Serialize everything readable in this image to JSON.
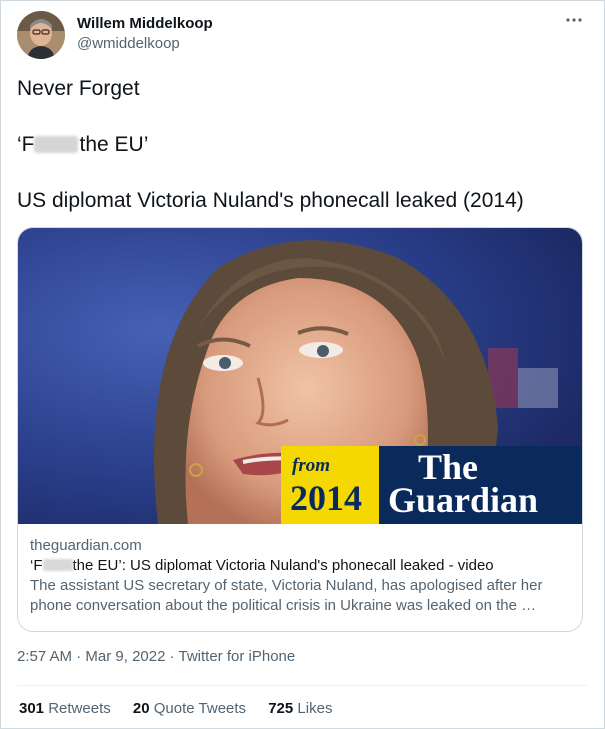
{
  "author": {
    "display_name": "Willem Middelkoop",
    "handle": "@wmiddelkoop"
  },
  "more_icon": "ellipsis-icon",
  "tweet": {
    "line1": "Never Forget",
    "line2_prefix": "‘F",
    "line2_suffix": "the EU’",
    "line3": "US diplomat Victoria Nuland's phonecall leaked  (2014)"
  },
  "card": {
    "badge_from": "from",
    "badge_year": "2014",
    "badge_brand_line1": "The",
    "badge_brand_line2": "Guardian",
    "domain": "theguardian.com",
    "title_prefix": "‘F",
    "title_suffix": "the EU’: US diplomat Victoria Nuland's phonecall leaked - video",
    "desc_line1": "The assistant US secretary of state, Victoria Nuland, has apologised after her",
    "desc_line2": "phone conversation about the political crisis in Ukraine was leaked on the …"
  },
  "meta": {
    "time": "2:57 AM",
    "date": "Mar 9, 2022",
    "source": "Twitter for iPhone",
    "separator": " · "
  },
  "stats": {
    "retweets_count": "301",
    "retweets_label": "Retweets",
    "quotes_count": "20",
    "quotes_label": "Quote Tweets",
    "likes_count": "725",
    "likes_label": "Likes"
  },
  "colors": {
    "guardian_yellow": "#f5d800",
    "guardian_blue": "#0b2a5c",
    "secondary_text": "#536471",
    "border": "#cfd9de"
  }
}
